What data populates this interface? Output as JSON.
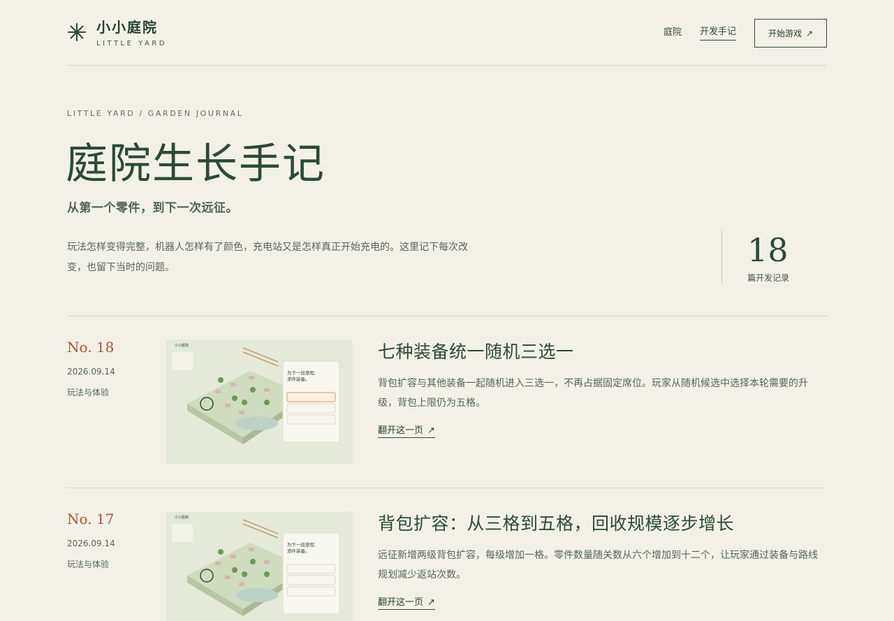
{
  "header": {
    "brand_cn": "小小庭院",
    "brand_en": "LITTLE YARD",
    "nav": [
      {
        "label": "庭院"
      },
      {
        "label": "开发手记"
      }
    ],
    "cta_label": "开始游戏",
    "cta_arrow": "↗"
  },
  "hero": {
    "eyebrow": "LITTLE YARD / GARDEN JOURNAL",
    "title": "庭院生长手记",
    "subtitle": "从第一个零件，到下一次远征。",
    "intro": "玩法怎样变得完整，机器人怎样有了颜色，充电站又是怎样真正开始充电的。这里记下每次改变，也留下当时的问题。",
    "stat_number": "18",
    "stat_label": "篇开发记录"
  },
  "entries": [
    {
      "no": "No. 18",
      "date": "2026.09.14",
      "category": "玩法与体验",
      "title": "七种装备统一随机三选一",
      "desc": "背包扩容与其他装备一起随机进入三选一，不再占据固定席位。玩家从随机候选中选择本轮需要的升级，背包上限仍为五格。",
      "more": "翻开这一页",
      "thumb": {
        "brand": "小小庭院",
        "card_title_1": "为下一段旅程,",
        "card_title_2": "添件装备。"
      }
    },
    {
      "no": "No. 17",
      "date": "2026.09.14",
      "category": "玩法与体验",
      "title": "背包扩容：从三格到五格，回收规模逐步增长",
      "desc": "远征新增两级背包扩容，每级增加一格。零件数量随关数从六个增加到十二个，让玩家通过装备与路线规划减少返站次数。",
      "more": "翻开这一页",
      "thumb": {
        "brand": "小小庭院",
        "card_title_1": "为下一段旅程,",
        "card_title_2": "添件装备。"
      }
    }
  ],
  "more_arrow": "↗",
  "colors": {
    "background": "#f3f1e7",
    "primary": "#2b4a36",
    "accent": "#b5502e",
    "divider": "#d6d3c4"
  },
  "icons": {
    "logo": "asterisk-logo-icon",
    "arrow": "arrow-up-right-icon"
  }
}
